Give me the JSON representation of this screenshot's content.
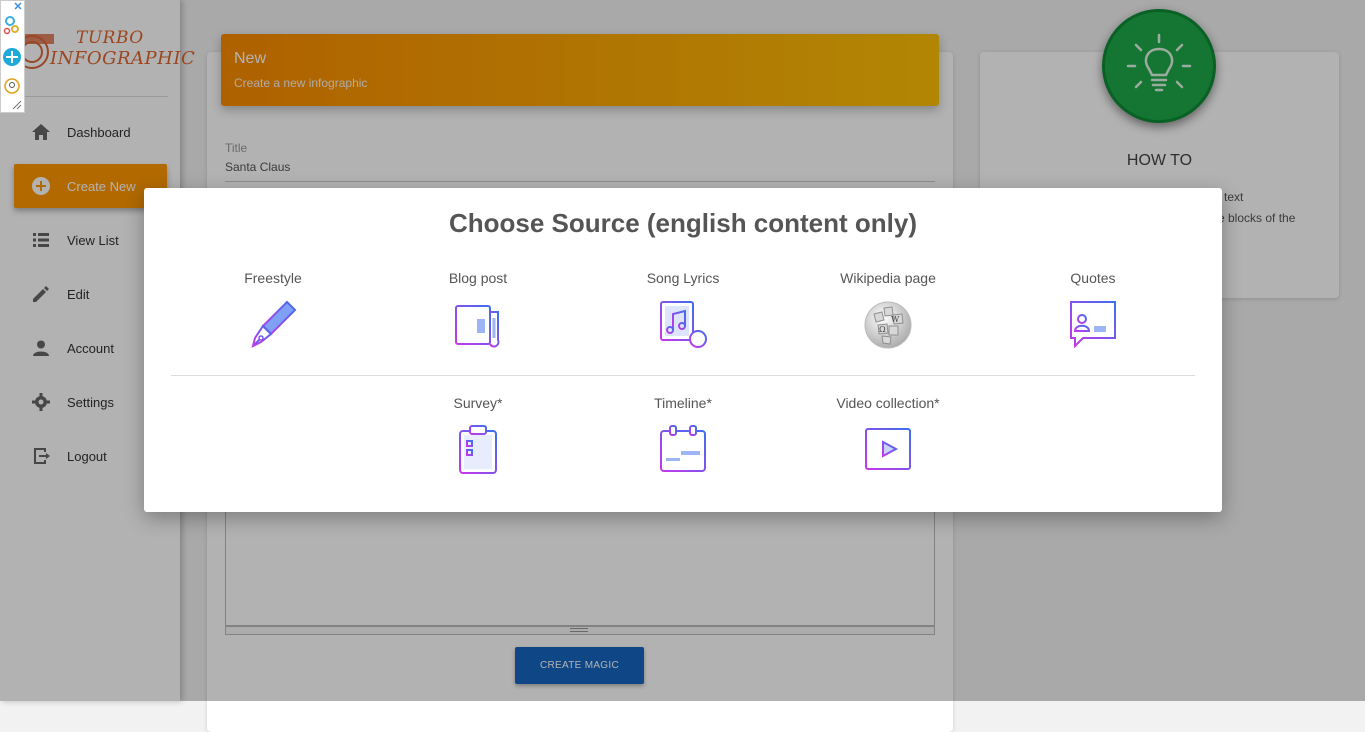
{
  "brand": {
    "line1": "TURBO",
    "line2": "INFOGRAPHIC"
  },
  "sidebar": {
    "items": [
      {
        "label": "Dashboard",
        "icon": "home-icon"
      },
      {
        "label": "Create New",
        "icon": "add-circle-icon",
        "active": true
      },
      {
        "label": "View List",
        "icon": "list-icon"
      },
      {
        "label": "Edit",
        "icon": "pencil-icon"
      },
      {
        "label": "Account",
        "icon": "person-icon"
      },
      {
        "label": "Settings",
        "icon": "gear-icon"
      },
      {
        "label": "Logout",
        "icon": "logout-icon"
      }
    ]
  },
  "main": {
    "header_title": "New",
    "header_subtitle": "Create a new infographic",
    "title_label": "Title",
    "title_value": "Santa Claus",
    "create_button": "CREATE MAGIC"
  },
  "howto": {
    "title": "HOW TO",
    "line1": "text",
    "line2": "e blocks of the"
  },
  "modal": {
    "title": "Choose Source (english content only)",
    "sources_row1": [
      {
        "label": "Freestyle",
        "icon": "pen-icon"
      },
      {
        "label": "Blog post",
        "icon": "newspaper-icon"
      },
      {
        "label": "Song Lyrics",
        "icon": "music-note-icon"
      },
      {
        "label": "Wikipedia page",
        "icon": "wikipedia-globe-icon"
      },
      {
        "label": "Quotes",
        "icon": "quote-profile-icon"
      }
    ],
    "sources_row2": [
      {
        "label": "Survey*",
        "icon": "clipboard-icon"
      },
      {
        "label": "Timeline*",
        "icon": "calendar-icon"
      },
      {
        "label": "Video collection*",
        "icon": "video-play-icon"
      }
    ]
  },
  "colors": {
    "accent_orange": "#ff9800",
    "button_blue": "#1565c0",
    "bulb_green": "#1faa4a",
    "icon_gradient_start": "#c837e8",
    "icon_gradient_end": "#3d6ff0"
  }
}
